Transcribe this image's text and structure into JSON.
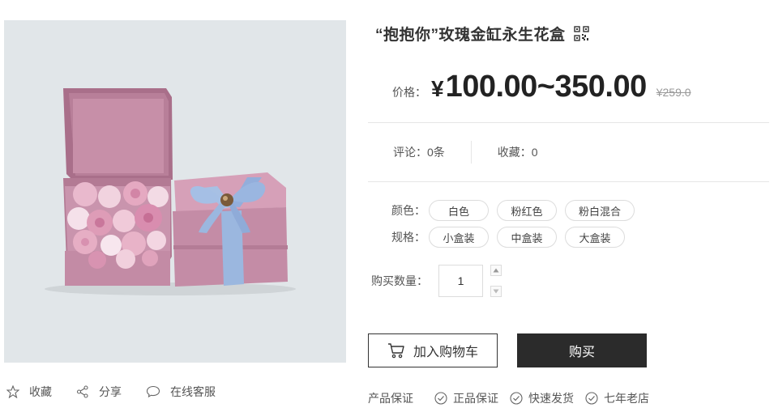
{
  "product": {
    "title": "“抱抱你”玫瑰金缸永生花盒",
    "qr_icon": "qr-code-icon"
  },
  "price": {
    "label": "价格：",
    "currency": "¥",
    "range": "100.00~350.00",
    "original": "¥259.0"
  },
  "stats": {
    "reviews": "评论：0条",
    "favorites": "收藏：0"
  },
  "options": {
    "color": {
      "label": "颜色：",
      "values": [
        "白色",
        "粉红色",
        "粉白混合"
      ]
    },
    "spec": {
      "label": "规格：",
      "values": [
        "小盒装",
        "中盒装",
        "大盒装"
      ]
    }
  },
  "quantity": {
    "label": "购买数量：",
    "value": "1"
  },
  "actions": {
    "add_to_cart": "加入购物车",
    "buy": "购买"
  },
  "guarantee": {
    "label": "产品保证",
    "items": [
      "正品保证",
      "快速发货",
      "七年老店"
    ]
  },
  "gallery_actions": {
    "favorite": "收藏",
    "share": "分享",
    "service": "在线客服"
  },
  "colors": {
    "box_pink": "#c58ea8",
    "ribbon_blue": "#9bb7df",
    "buy_button": "#2b2b2b",
    "image_bg": "#e1e6e9"
  }
}
